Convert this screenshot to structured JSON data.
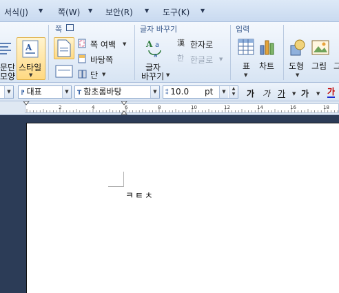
{
  "menu": {
    "items": [
      {
        "label": "서식(J)"
      },
      {
        "label": "쪽(W)"
      },
      {
        "label": "보안(R)"
      },
      {
        "label": "도구(K)"
      }
    ]
  },
  "ribbon": {
    "left_group": {
      "label_line1": "문단",
      "label_line2": "모양",
      "style_label": "스타일"
    },
    "page_group": {
      "title": "쪽",
      "margin_label": "쪽 여백",
      "background_label": "바탕쪽",
      "column_label": "단"
    },
    "convert_group": {
      "title": "글자 바꾸기",
      "convert_label_line1": "글자",
      "convert_label_line2": "바꾸기",
      "hanja_label": "한자로",
      "hangul_label": "한글로"
    },
    "input_group": {
      "title": "입력",
      "table_label": "표",
      "chart_label": "차트",
      "shape_label": "도형",
      "picture_label": "그림",
      "cut_label": "그"
    }
  },
  "format_bar": {
    "style_value": "대표",
    "font_value": "함초롬바탕",
    "size_value": "10.0",
    "size_unit": "pt",
    "bold": "가",
    "italic": "가",
    "underline": "가",
    "strike": "가",
    "color": "가"
  },
  "ruler": {
    "numbers": [
      "2",
      "4",
      "6",
      "8",
      "10",
      "12",
      "14",
      "16",
      "18"
    ]
  },
  "document": {
    "text": "ㅋㅌㅊ"
  }
}
